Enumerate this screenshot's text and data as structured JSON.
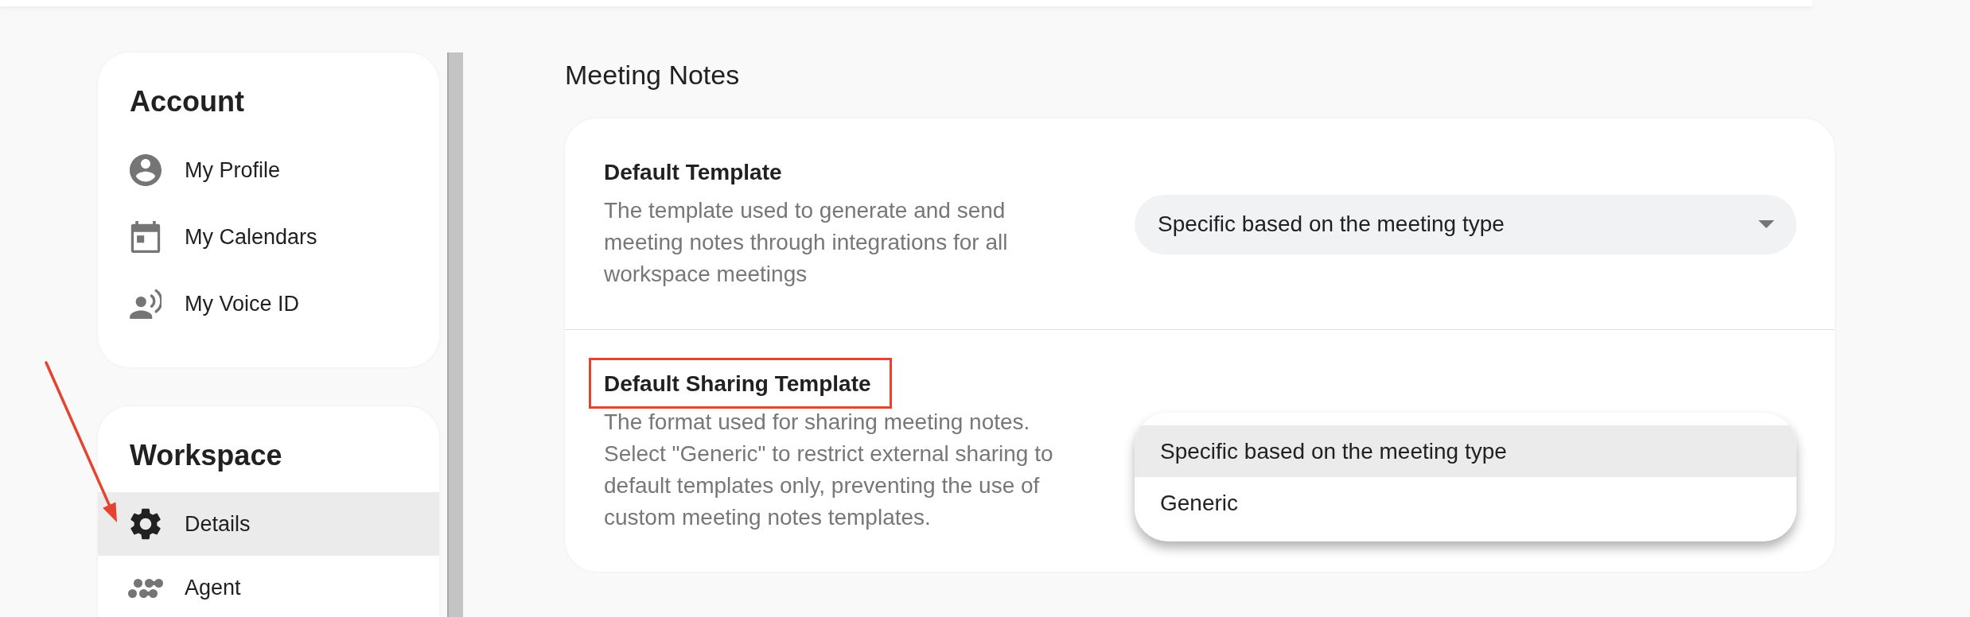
{
  "sidebar": {
    "sections": [
      {
        "title": "Account",
        "items": [
          {
            "label": "My Profile",
            "selected": false
          },
          {
            "label": "My Calendars",
            "selected": false
          },
          {
            "label": "My Voice ID",
            "selected": false
          }
        ]
      },
      {
        "title": "Workspace",
        "items": [
          {
            "label": "Details",
            "selected": true
          },
          {
            "label": "Agent",
            "selected": false
          }
        ]
      }
    ]
  },
  "main": {
    "title": "Meeting Notes",
    "settings": [
      {
        "label": "Default Template",
        "description": "The template used to generate and send meeting notes through integrations for all workspace meetings",
        "highlighted": false,
        "dropdown": {
          "open": false,
          "value": "Specific based on the meeting type"
        }
      },
      {
        "label": "Default Sharing Template",
        "description": "The format used for sharing meeting notes. Select \"Generic\" to restrict external sharing to default templates only, preventing the use of custom meeting notes templates.",
        "highlighted": true,
        "dropdown": {
          "open": true,
          "options": [
            {
              "label": "Specific based on the meeting type",
              "selected": true
            },
            {
              "label": "Generic",
              "selected": false
            }
          ]
        }
      }
    ]
  }
}
